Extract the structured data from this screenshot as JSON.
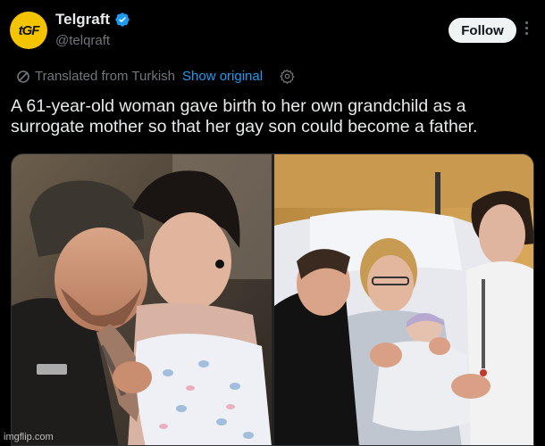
{
  "account": {
    "display_name": "Telgraft",
    "handle": "@telqraft",
    "avatar_text": "tGF",
    "verified": true,
    "follow_label": "Follow"
  },
  "translation": {
    "label": "Translated from Turkish",
    "show_original": "Show original"
  },
  "tweet": {
    "text": "A 61-year-old woman gave birth to her own grandchild as a surrogate mother so that her gay son could become a father."
  },
  "media": {
    "images": [
      {
        "name": "two-men-with-newborn-photo"
      },
      {
        "name": "hospital-bed-family-with-newborn-photo"
      }
    ]
  },
  "watermark": "imgflip.com",
  "colors": {
    "background": "#000000",
    "accent": "#1d9bf0",
    "avatar": "#f5c400",
    "muted": "#71767b"
  }
}
